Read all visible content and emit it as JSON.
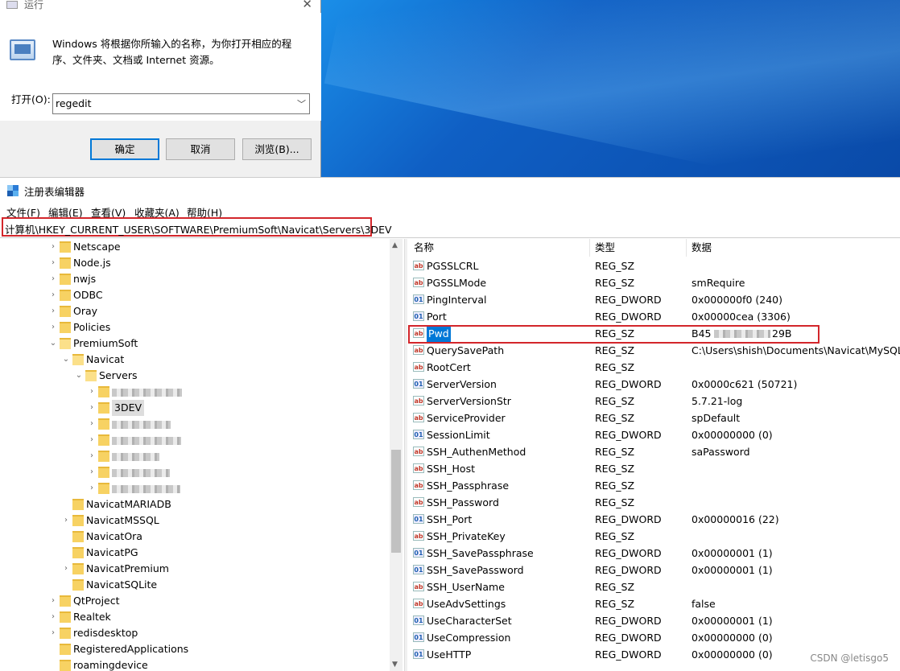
{
  "run_dialog": {
    "title": "运行",
    "description": "Windows 将根据你所输入的名称，为你打开相应的程序、文件夹、文档或 Internet 资源。",
    "open_label": "打开(O):",
    "input_value": "regedit",
    "ok": "确定",
    "cancel": "取消",
    "browse": "浏览(B)..."
  },
  "regedit": {
    "title": "注册表编辑器",
    "menu": [
      "文件(F)",
      "编辑(E)",
      "查看(V)",
      "收藏夹(A)",
      "帮助(H)"
    ],
    "address": "计算机\\HKEY_CURRENT_USER\\SOFTWARE\\PremiumSoft\\Navicat\\Servers\\3DEV",
    "tree": [
      {
        "label": "Netscape",
        "level": 0,
        "expand": "closed"
      },
      {
        "label": "Node.js",
        "level": 0,
        "expand": "closed"
      },
      {
        "label": "nwjs",
        "level": 0,
        "expand": "closed"
      },
      {
        "label": "ODBC",
        "level": 0,
        "expand": "closed"
      },
      {
        "label": "Oray",
        "level": 0,
        "expand": "closed"
      },
      {
        "label": "Policies",
        "level": 0,
        "expand": "closed"
      },
      {
        "label": "PremiumSoft",
        "level": 0,
        "expand": "open"
      },
      {
        "label": "Navicat",
        "level": 1,
        "expand": "open"
      },
      {
        "label": "Servers",
        "level": 2,
        "expand": "open"
      },
      {
        "label": "",
        "level": 3,
        "expand": "closed",
        "blurred": true
      },
      {
        "label": "3DEV",
        "level": 3,
        "expand": "closed",
        "selected": true
      },
      {
        "label": "",
        "level": 3,
        "expand": "closed",
        "blurred": true
      },
      {
        "label": "",
        "level": 3,
        "expand": "closed",
        "blurred": true
      },
      {
        "label": "",
        "level": 3,
        "expand": "closed",
        "blurred": true
      },
      {
        "label": "",
        "level": 3,
        "expand": "closed",
        "blurred": true
      },
      {
        "label": "",
        "level": 3,
        "expand": "closed",
        "blurred": true
      },
      {
        "label": "NavicatMARIADB",
        "level": 1,
        "expand": "none"
      },
      {
        "label": "NavicatMSSQL",
        "level": 1,
        "expand": "closed"
      },
      {
        "label": "NavicatOra",
        "level": 1,
        "expand": "none"
      },
      {
        "label": "NavicatPG",
        "level": 1,
        "expand": "none"
      },
      {
        "label": "NavicatPremium",
        "level": 1,
        "expand": "closed"
      },
      {
        "label": "NavicatSQLite",
        "level": 1,
        "expand": "none"
      },
      {
        "label": "QtProject",
        "level": 0,
        "expand": "closed"
      },
      {
        "label": "Realtek",
        "level": 0,
        "expand": "closed"
      },
      {
        "label": "redisdesktop",
        "level": 0,
        "expand": "closed"
      },
      {
        "label": "RegisteredApplications",
        "level": 0,
        "expand": "none"
      },
      {
        "label": "roamingdevice",
        "level": 0,
        "expand": "none"
      }
    ],
    "columns": [
      "名称",
      "类型",
      "数据"
    ],
    "values": [
      {
        "name": "PGSSLCRL",
        "type": "REG_SZ",
        "data": "",
        "icon": "sz"
      },
      {
        "name": "PGSSLMode",
        "type": "REG_SZ",
        "data": "smRequire",
        "icon": "sz"
      },
      {
        "name": "PingInterval",
        "type": "REG_DWORD",
        "data": "0x000000f0 (240)",
        "icon": "dw"
      },
      {
        "name": "Port",
        "type": "REG_DWORD",
        "data": "0x00000cea (3306)",
        "icon": "dw"
      },
      {
        "name": "Pwd",
        "type": "REG_SZ",
        "data": "B45",
        "data_end": "29B",
        "icon": "sz",
        "selected": true
      },
      {
        "name": "QuerySavePath",
        "type": "REG_SZ",
        "data": "C:\\Users\\shish\\Documents\\Navicat\\MySQL\\S",
        "icon": "sz"
      },
      {
        "name": "RootCert",
        "type": "REG_SZ",
        "data": "",
        "icon": "sz"
      },
      {
        "name": "ServerVersion",
        "type": "REG_DWORD",
        "data": "0x0000c621 (50721)",
        "icon": "dw"
      },
      {
        "name": "ServerVersionStr",
        "type": "REG_SZ",
        "data": "5.7.21-log",
        "icon": "sz"
      },
      {
        "name": "ServiceProvider",
        "type": "REG_SZ",
        "data": "spDefault",
        "icon": "sz"
      },
      {
        "name": "SessionLimit",
        "type": "REG_DWORD",
        "data": "0x00000000 (0)",
        "icon": "dw"
      },
      {
        "name": "SSH_AuthenMethod",
        "type": "REG_SZ",
        "data": "saPassword",
        "icon": "sz"
      },
      {
        "name": "SSH_Host",
        "type": "REG_SZ",
        "data": "",
        "icon": "sz"
      },
      {
        "name": "SSH_Passphrase",
        "type": "REG_SZ",
        "data": "",
        "icon": "sz"
      },
      {
        "name": "SSH_Password",
        "type": "REG_SZ",
        "data": "",
        "icon": "sz"
      },
      {
        "name": "SSH_Port",
        "type": "REG_DWORD",
        "data": "0x00000016 (22)",
        "icon": "dw"
      },
      {
        "name": "SSH_PrivateKey",
        "type": "REG_SZ",
        "data": "",
        "icon": "sz"
      },
      {
        "name": "SSH_SavePassphrase",
        "type": "REG_DWORD",
        "data": "0x00000001 (1)",
        "icon": "dw"
      },
      {
        "name": "SSH_SavePassword",
        "type": "REG_DWORD",
        "data": "0x00000001 (1)",
        "icon": "dw"
      },
      {
        "name": "SSH_UserName",
        "type": "REG_SZ",
        "data": "",
        "icon": "sz"
      },
      {
        "name": "UseAdvSettings",
        "type": "REG_SZ",
        "data": "false",
        "icon": "sz"
      },
      {
        "name": "UseCharacterSet",
        "type": "REG_DWORD",
        "data": "0x00000001 (1)",
        "icon": "dw"
      },
      {
        "name": "UseCompression",
        "type": "REG_DWORD",
        "data": "0x00000000 (0)",
        "icon": "dw"
      },
      {
        "name": "UseHTTP",
        "type": "REG_DWORD",
        "data": "0x00000000 (0)",
        "icon": "dw"
      }
    ],
    "icon_labels": {
      "sz": "ab",
      "dw": "01"
    }
  },
  "watermark": "CSDN @letisgo5"
}
